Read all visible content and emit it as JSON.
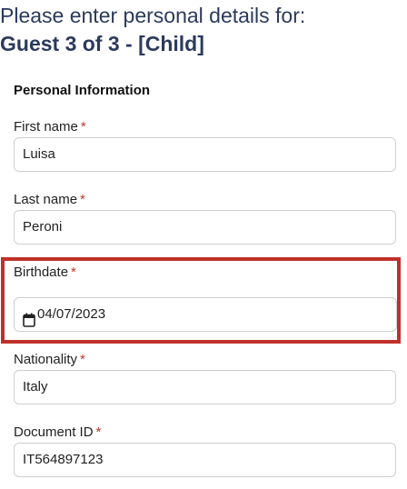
{
  "header": {
    "line1": "Please enter personal details for:",
    "line2": "Guest 3 of 3 - [Child]"
  },
  "section": {
    "title": "Personal Information"
  },
  "fields": {
    "first_name": {
      "label": "First name",
      "required": "*",
      "value": "Luisa"
    },
    "last_name": {
      "label": "Last name",
      "required": "*",
      "value": "Peroni"
    },
    "birthdate": {
      "label": "Birthdate",
      "required": "*",
      "value": "04/07/2023",
      "icon": "calendar-icon"
    },
    "nationality": {
      "label": "Nationality",
      "required": "*",
      "value": "Italy"
    },
    "document_id": {
      "label": "Document ID",
      "required": "*",
      "value": "IT564897123"
    }
  },
  "colors": {
    "heading": "#2b3a5c",
    "required_marker": "#c0392b",
    "highlight_border": "#c0302a",
    "input_border": "#cfcfcf"
  }
}
